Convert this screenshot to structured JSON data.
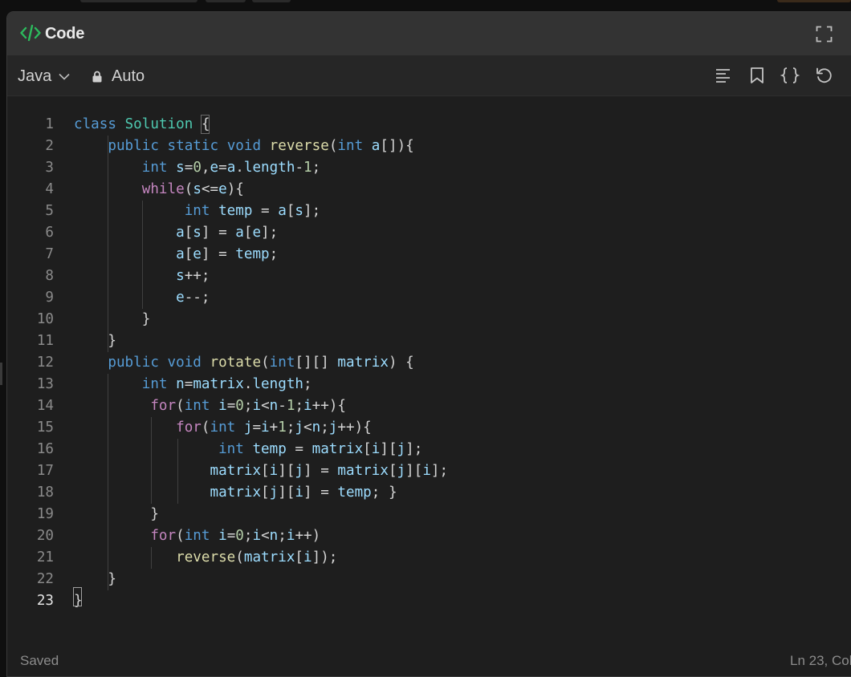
{
  "panel": {
    "title": "Code",
    "icon": "code-brackets-icon",
    "expand_icon": "expand-icon"
  },
  "toolbar": {
    "language": "Java",
    "language_icon": "chevron-down-icon",
    "mode": "Auto",
    "mode_icon": "lock-icon",
    "actions": [
      "format-icon",
      "bookmark-icon",
      "braces-icon",
      "reset-icon"
    ]
  },
  "editor": {
    "language": "java",
    "active_line": 23,
    "lines": [
      {
        "num": "1",
        "code": "class Solution {"
      },
      {
        "num": "2",
        "code": "    public static void reverse(int a[]){"
      },
      {
        "num": "3",
        "code": "        int s=0,e=a.length-1;"
      },
      {
        "num": "4",
        "code": "        while(s<=e){"
      },
      {
        "num": "5",
        "code": "             int temp = a[s];"
      },
      {
        "num": "6",
        "code": "            a[s] = a[e];"
      },
      {
        "num": "7",
        "code": "            a[e] = temp;"
      },
      {
        "num": "8",
        "code": "            s++;"
      },
      {
        "num": "9",
        "code": "            e--;"
      },
      {
        "num": "10",
        "code": "        }"
      },
      {
        "num": "11",
        "code": "    }"
      },
      {
        "num": "12",
        "code": "    public void rotate(int[][] matrix) {"
      },
      {
        "num": "13",
        "code": "        int n=matrix.length;"
      },
      {
        "num": "14",
        "code": "         for(int i=0;i<n-1;i++){"
      },
      {
        "num": "15",
        "code": "            for(int j=i+1;j<n;j++){"
      },
      {
        "num": "16",
        "code": "                 int temp = matrix[i][j];"
      },
      {
        "num": "17",
        "code": "                matrix[i][j] = matrix[j][i];"
      },
      {
        "num": "18",
        "code": "                matrix[j][i] = temp; }"
      },
      {
        "num": "19",
        "code": "         }"
      },
      {
        "num": "20",
        "code": "         for(int i=0;i<n;i++)"
      },
      {
        "num": "21",
        "code": "            reverse(matrix[i]);"
      },
      {
        "num": "22",
        "code": "    }"
      },
      {
        "num": "23",
        "code": "}"
      }
    ]
  },
  "status": {
    "saved": "Saved",
    "position": "Ln 23, Col"
  },
  "colors": {
    "accent_logo": "#2cbb5d",
    "keyword": "#569cd6",
    "control": "#c586c0",
    "class": "#4ec9b0",
    "function": "#dcdcaa",
    "variable": "#9cdcfe",
    "number": "#b5cea8"
  }
}
